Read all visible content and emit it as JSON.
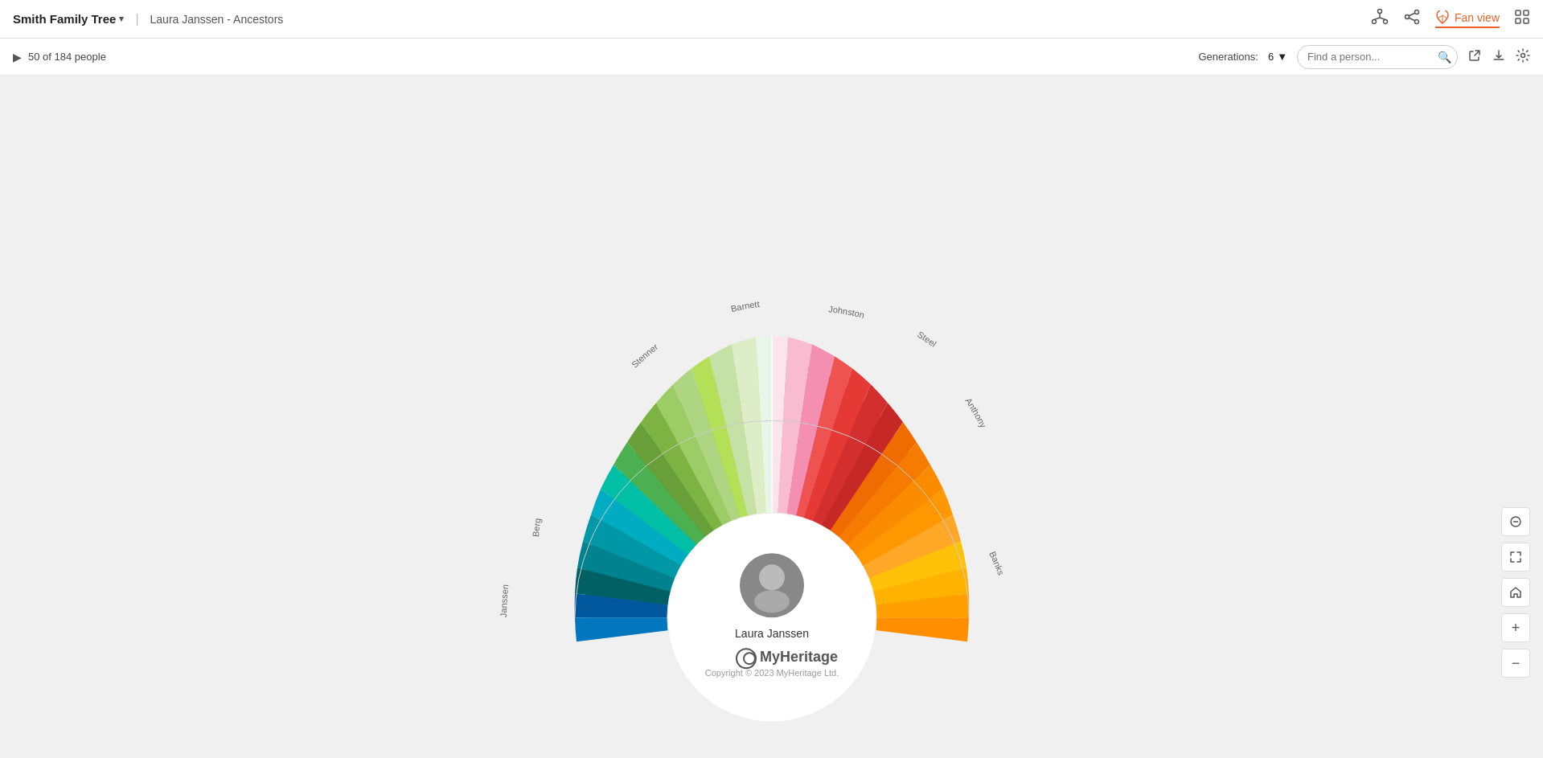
{
  "header": {
    "tree_title": "Smith Family Tree",
    "chevron": "▾",
    "separator": "|",
    "breadcrumb": "Laura Janssen  -  Ancestors",
    "icons": {
      "tree_icon": "⑂",
      "share_icon": "⑃",
      "fan_view_label": "Fan view",
      "fan_icon": "🔥",
      "grid_icon": "⊞"
    }
  },
  "toolbar": {
    "people_count": "50 of 184 people",
    "generations_label": "Generations:",
    "generations_value": "6",
    "find_placeholder": "Find a person...",
    "share_icon": "↗",
    "download_icon": "↓",
    "settings_icon": "⚙"
  },
  "fan": {
    "center_person": "Laura Janssen",
    "families": [
      "Janssen",
      "Berg",
      "Stenner",
      "Barnett",
      "Johnston",
      "Steel",
      "Anthony",
      "Banks"
    ],
    "colors": {
      "left_blue": [
        "#0288d1",
        "#0297c4",
        "#03a9c6",
        "#01bcd4",
        "#26c6da",
        "#4dd0e1",
        "#80deea",
        "#b2ebf2"
      ],
      "left_green": [
        "#00897b",
        "#26a69a",
        "#4db6ac",
        "#00bfa5",
        "#1de9b6",
        "#69f0ae",
        "#b9f6ca",
        "#ccff90"
      ],
      "left_lime": [
        "#8bc34a",
        "#9ccc65",
        "#aed581",
        "#cddc39",
        "#d4e157",
        "#e6ee9c",
        "#f0f4c3"
      ],
      "right_peach": [
        "#ffccbc",
        "#ffab91",
        "#ff8a65",
        "#ff7043",
        "#ff5722",
        "#f4511e",
        "#e64a19"
      ],
      "right_orange": [
        "#ff9800",
        "#ffa726",
        "#ffb74d",
        "#ffcc02",
        "#ffd740",
        "#ffe57f"
      ],
      "right_yellow": [
        "#ffc107",
        "#ffca28",
        "#ffd54f",
        "#ffe082",
        "#ffecb3"
      ]
    }
  },
  "logo": {
    "text": "⊙ MyHeritage",
    "copyright": "Copyright © 2023 MyHeritage Ltd."
  },
  "right_controls": {
    "hide_icon": "◎",
    "expand_icon": "⤢",
    "home_icon": "⌂",
    "zoom_in": "+",
    "zoom_out": "−"
  }
}
